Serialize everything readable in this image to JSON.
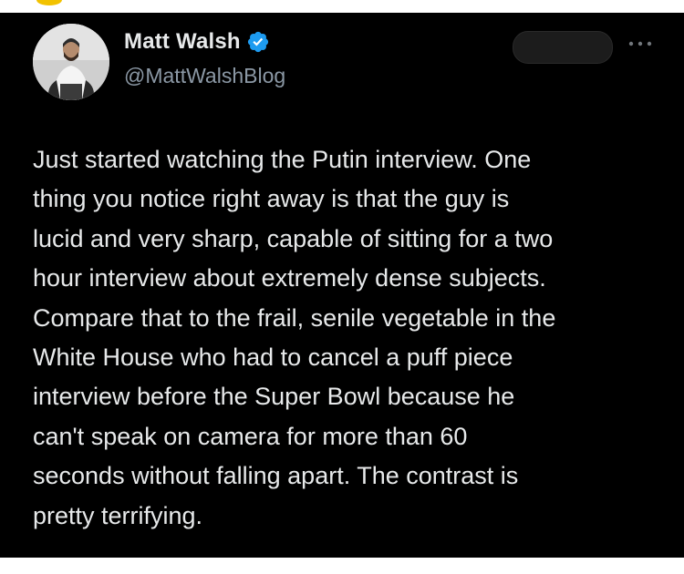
{
  "author": {
    "display_name": "Matt Walsh",
    "handle": "@MattWalshBlog",
    "verified": true,
    "avatar_icon": "profile-photo"
  },
  "actions": {
    "subscribe_label": "",
    "more_icon": "more-dots-icon"
  },
  "colors": {
    "background": "#000000",
    "text": "#e7e9ea",
    "handle": "#8b98a5",
    "verified_badge": "#1d9bf0"
  },
  "tweet": {
    "lines": [
      "Just started watching the Putin interview. One",
      "thing you notice right away is that the guy is",
      "lucid and very sharp, capable of sitting for a two",
      "hour interview about extremely dense subjects.",
      "Compare that to the frail, senile vegetable in the",
      "White House who had to cancel a puff piece",
      "interview before the Super Bowl because he",
      "can't speak on camera for more than 60",
      "seconds without falling apart. The contrast is",
      "pretty terrifying."
    ]
  }
}
